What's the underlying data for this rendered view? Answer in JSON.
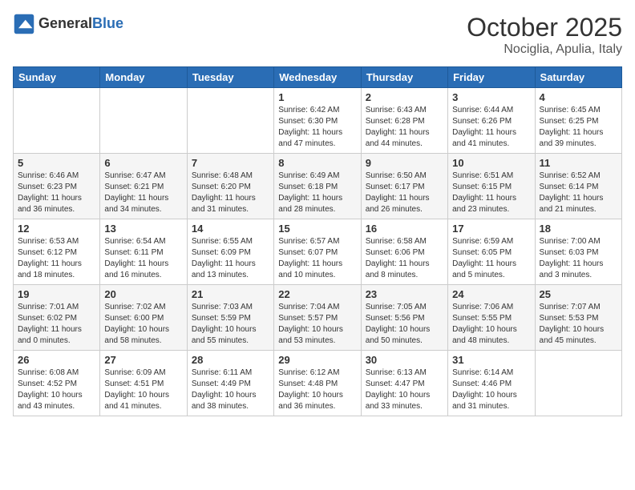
{
  "header": {
    "logo_general": "General",
    "logo_blue": "Blue",
    "month": "October 2025",
    "location": "Nociglia, Apulia, Italy"
  },
  "weekdays": [
    "Sunday",
    "Monday",
    "Tuesday",
    "Wednesday",
    "Thursday",
    "Friday",
    "Saturday"
  ],
  "weeks": [
    [
      {
        "day": "",
        "info": ""
      },
      {
        "day": "",
        "info": ""
      },
      {
        "day": "",
        "info": ""
      },
      {
        "day": "1",
        "info": "Sunrise: 6:42 AM\nSunset: 6:30 PM\nDaylight: 11 hours and 47 minutes."
      },
      {
        "day": "2",
        "info": "Sunrise: 6:43 AM\nSunset: 6:28 PM\nDaylight: 11 hours and 44 minutes."
      },
      {
        "day": "3",
        "info": "Sunrise: 6:44 AM\nSunset: 6:26 PM\nDaylight: 11 hours and 41 minutes."
      },
      {
        "day": "4",
        "info": "Sunrise: 6:45 AM\nSunset: 6:25 PM\nDaylight: 11 hours and 39 minutes."
      }
    ],
    [
      {
        "day": "5",
        "info": "Sunrise: 6:46 AM\nSunset: 6:23 PM\nDaylight: 11 hours and 36 minutes."
      },
      {
        "day": "6",
        "info": "Sunrise: 6:47 AM\nSunset: 6:21 PM\nDaylight: 11 hours and 34 minutes."
      },
      {
        "day": "7",
        "info": "Sunrise: 6:48 AM\nSunset: 6:20 PM\nDaylight: 11 hours and 31 minutes."
      },
      {
        "day": "8",
        "info": "Sunrise: 6:49 AM\nSunset: 6:18 PM\nDaylight: 11 hours and 28 minutes."
      },
      {
        "day": "9",
        "info": "Sunrise: 6:50 AM\nSunset: 6:17 PM\nDaylight: 11 hours and 26 minutes."
      },
      {
        "day": "10",
        "info": "Sunrise: 6:51 AM\nSunset: 6:15 PM\nDaylight: 11 hours and 23 minutes."
      },
      {
        "day": "11",
        "info": "Sunrise: 6:52 AM\nSunset: 6:14 PM\nDaylight: 11 hours and 21 minutes."
      }
    ],
    [
      {
        "day": "12",
        "info": "Sunrise: 6:53 AM\nSunset: 6:12 PM\nDaylight: 11 hours and 18 minutes."
      },
      {
        "day": "13",
        "info": "Sunrise: 6:54 AM\nSunset: 6:11 PM\nDaylight: 11 hours and 16 minutes."
      },
      {
        "day": "14",
        "info": "Sunrise: 6:55 AM\nSunset: 6:09 PM\nDaylight: 11 hours and 13 minutes."
      },
      {
        "day": "15",
        "info": "Sunrise: 6:57 AM\nSunset: 6:07 PM\nDaylight: 11 hours and 10 minutes."
      },
      {
        "day": "16",
        "info": "Sunrise: 6:58 AM\nSunset: 6:06 PM\nDaylight: 11 hours and 8 minutes."
      },
      {
        "day": "17",
        "info": "Sunrise: 6:59 AM\nSunset: 6:05 PM\nDaylight: 11 hours and 5 minutes."
      },
      {
        "day": "18",
        "info": "Sunrise: 7:00 AM\nSunset: 6:03 PM\nDaylight: 11 hours and 3 minutes."
      }
    ],
    [
      {
        "day": "19",
        "info": "Sunrise: 7:01 AM\nSunset: 6:02 PM\nDaylight: 11 hours and 0 minutes."
      },
      {
        "day": "20",
        "info": "Sunrise: 7:02 AM\nSunset: 6:00 PM\nDaylight: 10 hours and 58 minutes."
      },
      {
        "day": "21",
        "info": "Sunrise: 7:03 AM\nSunset: 5:59 PM\nDaylight: 10 hours and 55 minutes."
      },
      {
        "day": "22",
        "info": "Sunrise: 7:04 AM\nSunset: 5:57 PM\nDaylight: 10 hours and 53 minutes."
      },
      {
        "day": "23",
        "info": "Sunrise: 7:05 AM\nSunset: 5:56 PM\nDaylight: 10 hours and 50 minutes."
      },
      {
        "day": "24",
        "info": "Sunrise: 7:06 AM\nSunset: 5:55 PM\nDaylight: 10 hours and 48 minutes."
      },
      {
        "day": "25",
        "info": "Sunrise: 7:07 AM\nSunset: 5:53 PM\nDaylight: 10 hours and 45 minutes."
      }
    ],
    [
      {
        "day": "26",
        "info": "Sunrise: 6:08 AM\nSunset: 4:52 PM\nDaylight: 10 hours and 43 minutes."
      },
      {
        "day": "27",
        "info": "Sunrise: 6:09 AM\nSunset: 4:51 PM\nDaylight: 10 hours and 41 minutes."
      },
      {
        "day": "28",
        "info": "Sunrise: 6:11 AM\nSunset: 4:49 PM\nDaylight: 10 hours and 38 minutes."
      },
      {
        "day": "29",
        "info": "Sunrise: 6:12 AM\nSunset: 4:48 PM\nDaylight: 10 hours and 36 minutes."
      },
      {
        "day": "30",
        "info": "Sunrise: 6:13 AM\nSunset: 4:47 PM\nDaylight: 10 hours and 33 minutes."
      },
      {
        "day": "31",
        "info": "Sunrise: 6:14 AM\nSunset: 4:46 PM\nDaylight: 10 hours and 31 minutes."
      },
      {
        "day": "",
        "info": ""
      }
    ]
  ]
}
